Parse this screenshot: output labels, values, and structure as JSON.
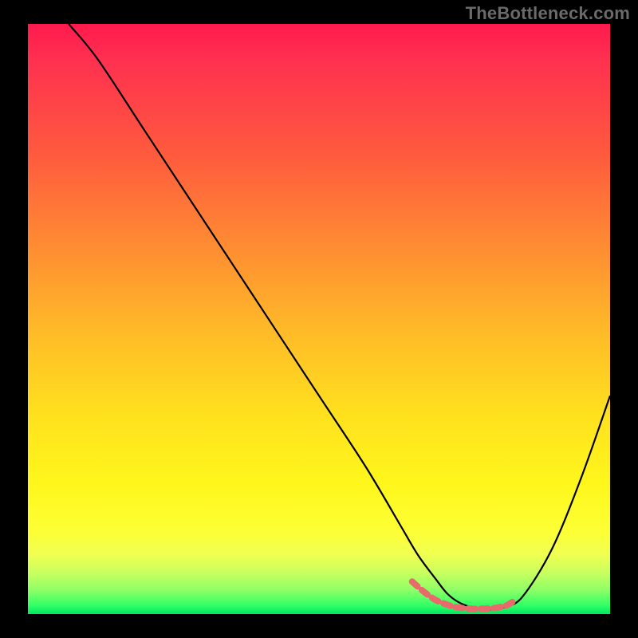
{
  "watermark": "TheBottleneck.com",
  "chart_data": {
    "type": "line",
    "title": "",
    "xlabel": "",
    "ylabel": "",
    "xlim": [
      0,
      100
    ],
    "ylim": [
      0,
      100
    ],
    "series": [
      {
        "name": "main-curve",
        "color": "#000000",
        "x": [
          7,
          12,
          20,
          30,
          40,
          50,
          58,
          64,
          67,
          70,
          72,
          74,
          76,
          78,
          80,
          82,
          85,
          90,
          95,
          100
        ],
        "y": [
          100,
          94,
          82,
          67,
          52,
          37,
          25,
          15,
          10,
          6,
          3.5,
          2,
          1.2,
          0.8,
          0.8,
          1.2,
          3,
          11,
          23,
          37
        ]
      },
      {
        "name": "bottom-marker",
        "color": "#e86a6a",
        "x": [
          66,
          68,
          70,
          72,
          73,
          74,
          76,
          78,
          80,
          82,
          83,
          84
        ],
        "y": [
          5.5,
          3.8,
          2.4,
          1.6,
          1.3,
          1.1,
          0.9,
          0.9,
          1.0,
          1.4,
          1.9,
          2.6
        ]
      }
    ],
    "gradient_note": "vertical heat gradient from red (top) through orange/yellow to green (bottom) fills the plot background"
  },
  "colors": {
    "frame": "#000000",
    "watermark": "#6a6a6a",
    "curve": "#000000",
    "marker": "#e86a6a"
  }
}
